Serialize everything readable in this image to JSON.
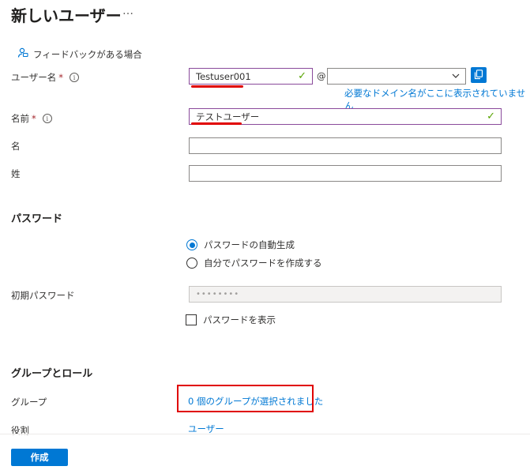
{
  "header": {
    "title": "新しいユーザー",
    "more": "…"
  },
  "feedback": {
    "label": "フィードバックがある場合"
  },
  "form": {
    "username": {
      "label": "ユーザー名",
      "required_mark": "*",
      "value": "Testuser001",
      "at": "@",
      "domain_value": "",
      "domain_hint": "必要なドメイン名がここに表示されていません"
    },
    "name": {
      "label": "名前",
      "required_mark": "*",
      "value": "テストユーザー"
    },
    "first_name": {
      "label": "名",
      "value": ""
    },
    "last_name": {
      "label": "姓",
      "value": ""
    }
  },
  "password": {
    "section_title": "パスワード",
    "options": [
      "パスワードの自動生成",
      "自分でパスワードを作成する"
    ],
    "selected_option": 0,
    "initial_label": "初期パスワード",
    "initial_value": "••••••••",
    "show_label": "パスワードを表示",
    "show_checked": false
  },
  "groups_roles": {
    "section_title": "グループとロール",
    "group_label": "グループ",
    "group_value": "0 個のグループが選択されました",
    "role_label": "役割",
    "role_value": "ユーザー"
  },
  "footer": {
    "create_label": "作成"
  },
  "colors": {
    "accent": "#0078d4",
    "highlight": "#e00000",
    "valid_border": "#8a4a9b",
    "check": "#57a300"
  },
  "icons": {
    "feedback": "feedback-person-icon",
    "info": "info-icon",
    "check": "checkmark-icon",
    "copy": "copy-icon",
    "chevron": "chevron-down-icon"
  }
}
